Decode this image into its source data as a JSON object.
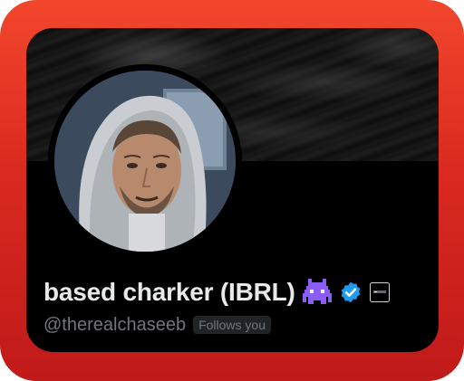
{
  "profile": {
    "display_name": "based charker (IBRL)",
    "handle": "@therealchaseeb",
    "follows_you_label": "Follows you",
    "icons": [
      "alien-monster-icon",
      "verified-badge-icon",
      "affiliate-badge-icon"
    ]
  },
  "colors": {
    "frame": "#e0301f",
    "card_background": "#000000",
    "name_text": "#e7e9ea",
    "secondary_text": "#71767b",
    "badge_background": "#202327",
    "verified_blue": "#1d9bf0",
    "alien_purple": "#8b5cf6"
  }
}
